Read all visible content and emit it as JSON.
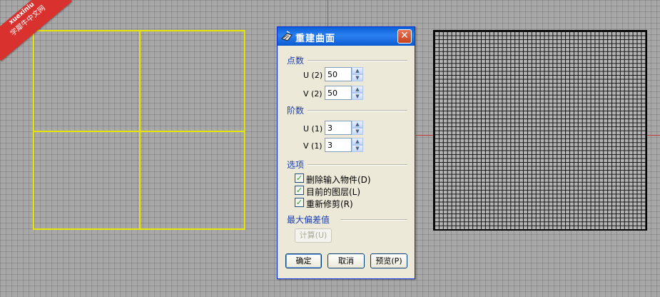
{
  "watermark": {
    "line1": "xuexiniu",
    "line2": "学犀牛中文网"
  },
  "dialog": {
    "title": "重建曲面",
    "close_glyph": "✕",
    "groups": {
      "point_count": "点数",
      "degree": "阶数",
      "options": "选项",
      "max_deviation": "最大偏差值"
    },
    "points": {
      "u_label": "U (2)",
      "u_value": "50",
      "v_label": "V (2)",
      "v_value": "50"
    },
    "degree": {
      "u_label": "U (1)",
      "u_value": "3",
      "v_label": "V (1)",
      "v_value": "3"
    },
    "options": [
      {
        "label": "删除输入物件(D)",
        "checked": true
      },
      {
        "label": "目前的图层(L)",
        "checked": true
      },
      {
        "label": "重新修剪(R)",
        "checked": true
      }
    ],
    "calculate_label": "计算(U)",
    "ok_label": "确定",
    "cancel_label": "取消",
    "preview_label": "预览(P)",
    "check_glyph": "✓",
    "spin_up_glyph": "▲",
    "spin_down_glyph": "▼"
  },
  "colors": {
    "viewport_bg": "#a8a8a8",
    "input_surface": "#e6e600",
    "y_axis": "#1fa21f",
    "x_axis": "#c0383a",
    "dialog_title_bar": "#0a5fd8",
    "group_label": "#1b3fb0"
  },
  "icons": [
    "rebuild-surface-icon",
    "close-icon",
    "checkbox-checked-icon",
    "spin-up-icon",
    "spin-down-icon"
  ]
}
